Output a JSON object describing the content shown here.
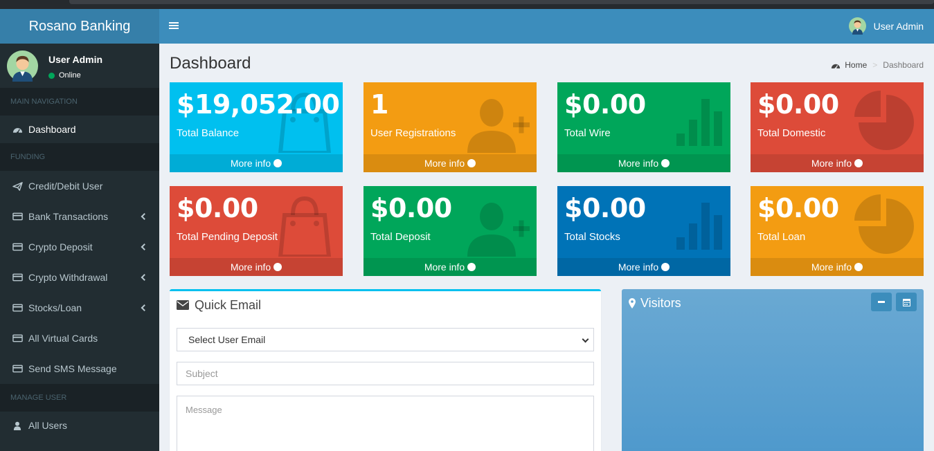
{
  "app": {
    "title": "Rosano Banking"
  },
  "navbar": {
    "user_name": "User Admin"
  },
  "sidebar": {
    "user": {
      "name": "User Admin",
      "status": "Online"
    },
    "sections": {
      "main": "MAIN NAVIGATION",
      "funding": "FUNDING",
      "manage": "MANAGE USER"
    },
    "items": [
      {
        "label": "Dashboard",
        "icon": "dashboard-icon"
      },
      {
        "label": "Credit/Debit User",
        "icon": "paper-plane-icon"
      },
      {
        "label": "Bank Transactions",
        "icon": "credit-card-icon"
      },
      {
        "label": "Crypto Deposit",
        "icon": "credit-card-icon"
      },
      {
        "label": "Crypto Withdrawal",
        "icon": "credit-card-icon"
      },
      {
        "label": "Stocks/Loan",
        "icon": "credit-card-icon"
      },
      {
        "label": "All Virtual Cards",
        "icon": "credit-card-icon"
      },
      {
        "label": "Send SMS Message",
        "icon": "credit-card-icon"
      },
      {
        "label": "All Users",
        "icon": "user-icon"
      }
    ]
  },
  "page": {
    "title": "Dashboard",
    "breadcrumb": {
      "home": "Home",
      "current": "Dashboard"
    }
  },
  "stats": [
    {
      "value": "$19,052.00",
      "label": "Total Balance",
      "footer": "More info",
      "color": "#00c0ef",
      "icon": "shopping-bag-icon"
    },
    {
      "value": "1",
      "label": "User Registrations",
      "footer": "More info",
      "color": "#f39c12",
      "icon": "user-plus-icon"
    },
    {
      "value": "$0.00",
      "label": "Total Wire",
      "footer": "More info",
      "color": "#00a65a",
      "icon": "bar-chart-icon"
    },
    {
      "value": "$0.00",
      "label": "Total Domestic",
      "footer": "More info",
      "color": "#dd4b39",
      "icon": "pie-chart-icon"
    },
    {
      "value": "$0.00",
      "label": "Total Pending Deposit",
      "footer": "More info",
      "color": "#dd4b39",
      "icon": "shopping-bag-icon"
    },
    {
      "value": "$0.00",
      "label": "Total Deposit",
      "footer": "More info",
      "color": "#00a65a",
      "icon": "user-plus-icon"
    },
    {
      "value": "$0.00",
      "label": "Total Stocks",
      "footer": "More info",
      "color": "#0073b7",
      "icon": "bar-chart-icon"
    },
    {
      "value": "$0.00",
      "label": "Total Loan",
      "footer": "More info",
      "color": "#f39c12",
      "icon": "pie-chart-icon"
    }
  ],
  "quick_email": {
    "title": "Quick Email",
    "select_placeholder": "Select User Email",
    "subject_placeholder": "Subject",
    "message_placeholder": "Message"
  },
  "visitors": {
    "title": "Visitors"
  },
  "colors": {
    "navbar": "#3c8dbc",
    "logo": "#367fa9",
    "sidebar": "#222d32",
    "content_bg": "#ecf0f5"
  }
}
